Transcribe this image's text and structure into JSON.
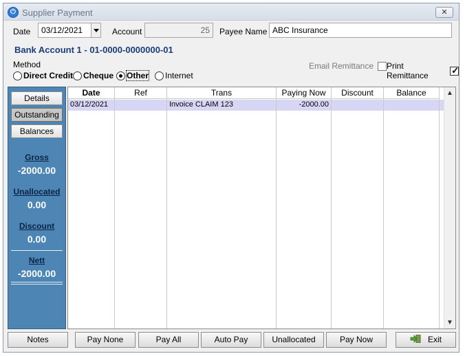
{
  "window": {
    "title": "Supplier Payment",
    "close_label": "✕"
  },
  "form": {
    "date_label": "Date",
    "date_value": "03/12/2021",
    "account_label": "Account",
    "account_value": "25",
    "payee_label": "Payee Name",
    "payee_value": "ABC Insurance",
    "bank_account": "Bank Account 1 - 01-0000-0000000-01",
    "method_label": "Method",
    "methods": [
      {
        "label": "Direct Credit",
        "selected": false
      },
      {
        "label": "Cheque",
        "selected": false
      },
      {
        "label": "Other",
        "selected": true
      },
      {
        "label": "Internet",
        "selected": false
      }
    ],
    "email_remittance_label": "Email Remittance",
    "email_remittance_checked": false,
    "print_remittance_label": "Print Remittance",
    "print_remittance_checked": true
  },
  "sidebar": {
    "buttons": [
      "Details",
      "Outstanding",
      "Balances"
    ],
    "active": "Outstanding",
    "gross_label": "Gross",
    "gross_value": "-2000.00",
    "unallocated_label": "Unallocated",
    "unallocated_value": "0.00",
    "discount_label": "Discount",
    "discount_value": "0.00",
    "nett_label": "Nett",
    "nett_value": "-2000.00"
  },
  "grid": {
    "columns": [
      "Date",
      "Ref",
      "Trans",
      "Paying Now",
      "Discount",
      "Balance"
    ],
    "rows": [
      {
        "date": "03/12/2021",
        "ref": "",
        "trans": "Invoice CLAIM 123",
        "paying_now": "-2000.00",
        "discount": "",
        "balance": ""
      }
    ]
  },
  "buttons": {
    "notes": "Notes",
    "pay_none": "Pay None",
    "pay_all": "Pay All",
    "auto_pay": "Auto Pay",
    "unallocated": "Unallocated",
    "pay_now": "Pay Now",
    "exit": "Exit"
  },
  "colors": {
    "sidebar_bg": "#4d86b5",
    "selected_row": "#d7d6f5",
    "bank_title": "#1a3d7c"
  }
}
